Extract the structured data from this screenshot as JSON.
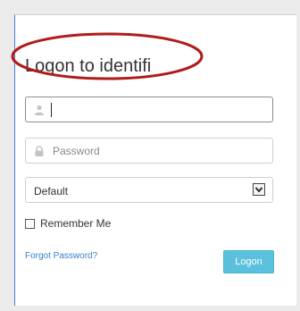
{
  "login": {
    "title": "Logon to identifi",
    "username": {
      "value": "",
      "placeholder": ""
    },
    "password": {
      "value": "",
      "placeholder": "Password"
    },
    "domain": {
      "selected": "Default"
    },
    "remember_label": "Remember Me",
    "remember_checked": false,
    "forgot_link": "Forgot Password?",
    "logon_button": "Logon"
  },
  "colors": {
    "accent_button": "#5bc0de",
    "link": "#3a80c8",
    "highlight_ellipse": "#b01c1c"
  },
  "icons": {
    "username": "user-icon",
    "password": "lock-icon",
    "dropdown": "chevron-down-icon"
  }
}
